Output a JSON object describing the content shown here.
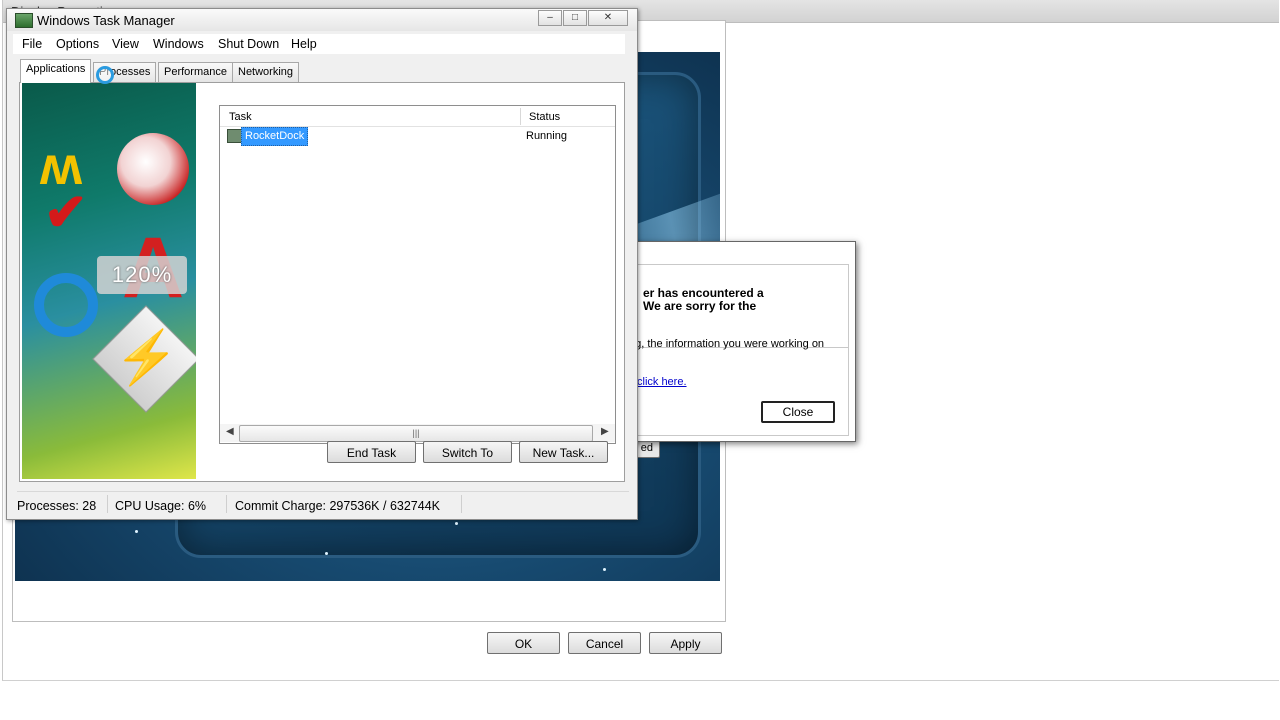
{
  "display_properties": {
    "title": "Display Properties",
    "buttons": {
      "ok": "OK",
      "cancel": "Cancel",
      "apply": "Apply"
    }
  },
  "error_dialog": {
    "heading_line1": "er has encountered a",
    "heading_line2": "We are sorry for the",
    "body_text": "ng, the information you were working on",
    "link_prefix": ",",
    "link_text": "click here.",
    "close_label": "Close",
    "partial_button_label": "ed"
  },
  "task_manager": {
    "title": "Windows Task Manager",
    "window_buttons": {
      "minimize": "–",
      "maximize": "□",
      "close": "✕"
    },
    "menu": [
      "File",
      "Options",
      "View",
      "Windows",
      "Shut Down",
      "Help"
    ],
    "tabs": [
      "Applications",
      "Processes",
      "Performance",
      "Networking"
    ],
    "active_tab": "Applications",
    "columns": {
      "task": "Task",
      "status": "Status"
    },
    "tasks": [
      {
        "name": "RocketDock",
        "status": "Running"
      }
    ],
    "buttons": {
      "end_task": "End Task",
      "switch_to": "Switch To",
      "new_task": "New Task..."
    },
    "zoom_overlay": "120%",
    "statusbar": {
      "processes": "Processes: 28",
      "cpu": "CPU Usage: 6%",
      "commit": "Commit Charge: 297536K / 632744K"
    }
  },
  "colors": {
    "selection": "#3399ff",
    "link": "#0000cc",
    "preview_bg": "#174a70"
  }
}
